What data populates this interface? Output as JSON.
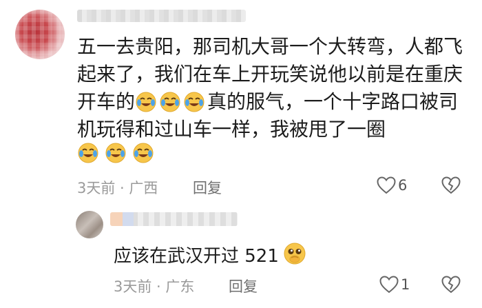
{
  "main_comment": {
    "avatar": "user-avatar-blurred",
    "username": "",
    "text": "五一去贵阳，那司机大哥一个大转弯，人都飞起来了，我们在车上开玩笑说他以前是在重庆开车的",
    "text_after_emoji": "真的服气，一个十字路口被司机玩得和过山车一样，我被甩了一圈",
    "inline_emojis": [
      "laughing-crying-emoji",
      "laughing-crying-emoji",
      "laughing-crying-emoji"
    ],
    "trailing_emojis": [
      "laughing-crying-emoji",
      "laughing-crying-emoji",
      "laughing-crying-emoji"
    ],
    "meta": "3天前 · 广西",
    "reply_label": "回复",
    "like_count": "6",
    "like_icon": "heart-outline-icon",
    "dislike_icon": "broken-heart-icon"
  },
  "reply_comment": {
    "avatar": "user-avatar-blurred",
    "username": "",
    "text": "应该在武汉开过 521",
    "emoji": "pleading-face-emoji",
    "meta": "3天前 · 广东",
    "reply_label": "回复",
    "like_count": "1",
    "like_icon": "heart-outline-icon",
    "dislike_icon": "broken-heart-icon"
  },
  "colors": {
    "text": "#1c1c1c",
    "meta": "#9a9a9a",
    "emoji_face": "#f7c64b"
  }
}
